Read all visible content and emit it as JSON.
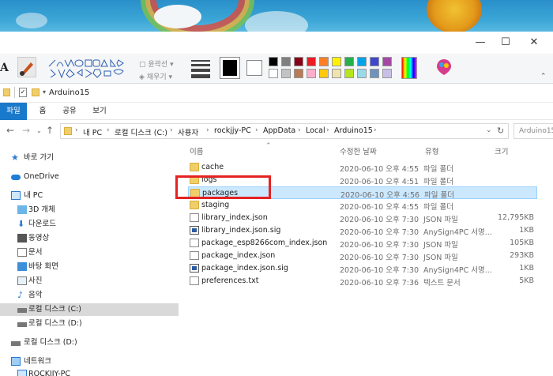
{
  "paint": {
    "labels": {
      "outline": "윤곽선",
      "fill": "채우기"
    },
    "window_controls": {
      "minimize": "—",
      "maximize": "☐",
      "close": "✕"
    },
    "colors": [
      "#000000",
      "#7f7f7f",
      "#880015",
      "#ed1c24",
      "#ff7f27",
      "#fff200",
      "#22b14c",
      "#00a2e8",
      "#3f48cc",
      "#a349a4",
      "#ffffff",
      "#c3c3c3",
      "#b97a57",
      "#ffaec9",
      "#ffc90e",
      "#efe4b0",
      "#b5e61d",
      "#99d9ea",
      "#7092be",
      "#c8bfe7"
    ]
  },
  "explorer": {
    "title": "Arduino15",
    "tabs": [
      "파일",
      "홈",
      "공유",
      "보기"
    ],
    "breadcrumb": [
      "내 PC",
      "로컬 디스크 (C:)",
      "사용자",
      "rockjjy-PC",
      "AppData",
      "Local",
      "Arduino15"
    ],
    "search_placeholder": "Arduino15",
    "nav": [
      {
        "label": "바로 가기",
        "icon": "star-icon"
      },
      {
        "label": "OneDrive",
        "icon": "cloud-icon"
      },
      {
        "label": "내 PC",
        "icon": "computer-icon"
      },
      {
        "label": "3D 개체",
        "icon": "cube-icon"
      },
      {
        "label": "다운로드",
        "icon": "download-icon"
      },
      {
        "label": "동영상",
        "icon": "video-icon"
      },
      {
        "label": "문서",
        "icon": "document-icon"
      },
      {
        "label": "바탕 화면",
        "icon": "desktop-icon"
      },
      {
        "label": "사진",
        "icon": "picture-icon"
      },
      {
        "label": "음악",
        "icon": "music-icon"
      },
      {
        "label": "로컬 디스크 (C:)",
        "icon": "drive-icon"
      },
      {
        "label": "로컬 디스크 (D:)",
        "icon": "drive-icon"
      },
      {
        "label": "로컬 디스크 (D:)",
        "icon": "drive-icon"
      },
      {
        "label": "네트워크",
        "icon": "network-icon"
      },
      {
        "label": "ROCKJJY-PC",
        "icon": "computer-icon"
      }
    ],
    "columns": {
      "name": "이름",
      "date": "수정한 날짜",
      "type": "유형",
      "size": "크기"
    },
    "files": [
      {
        "name": "cache",
        "date": "2020-06-10 오후 4:55",
        "type": "파일 폴더",
        "size": "",
        "icon": "folder-icon"
      },
      {
        "name": "logs",
        "date": "2020-06-10 오후 4:51",
        "type": "파일 폴더",
        "size": "",
        "icon": "folder-icon"
      },
      {
        "name": "packages",
        "date": "2020-06-10 오후 4:56",
        "type": "파일 폴더",
        "size": "",
        "icon": "folder-icon"
      },
      {
        "name": "staging",
        "date": "2020-06-10 오후 4:55",
        "type": "파일 폴더",
        "size": "",
        "icon": "folder-icon"
      },
      {
        "name": "library_index.json",
        "date": "2020-06-10 오후 7:30",
        "type": "JSON 파일",
        "size": "12,795KB",
        "icon": "file-icon"
      },
      {
        "name": "library_index.json.sig",
        "date": "2020-06-10 오후 7:30",
        "type": "AnySign4PC 서명...",
        "size": "1KB",
        "icon": "signature-file-icon"
      },
      {
        "name": "package_esp8266com_index.json",
        "date": "2020-06-10 오후 7:30",
        "type": "JSON 파일",
        "size": "105KB",
        "icon": "file-icon"
      },
      {
        "name": "package_index.json",
        "date": "2020-06-10 오후 7:30",
        "type": "JSON 파일",
        "size": "293KB",
        "icon": "file-icon"
      },
      {
        "name": "package_index.json.sig",
        "date": "2020-06-10 오후 7:30",
        "type": "AnySign4PC 서명...",
        "size": "1KB",
        "icon": "signature-file-icon"
      },
      {
        "name": "preferences.txt",
        "date": "2020-06-10 오후 7:36",
        "type": "텍스트 문서",
        "size": "5KB",
        "icon": "file-icon"
      }
    ],
    "selected_file": "packages"
  }
}
